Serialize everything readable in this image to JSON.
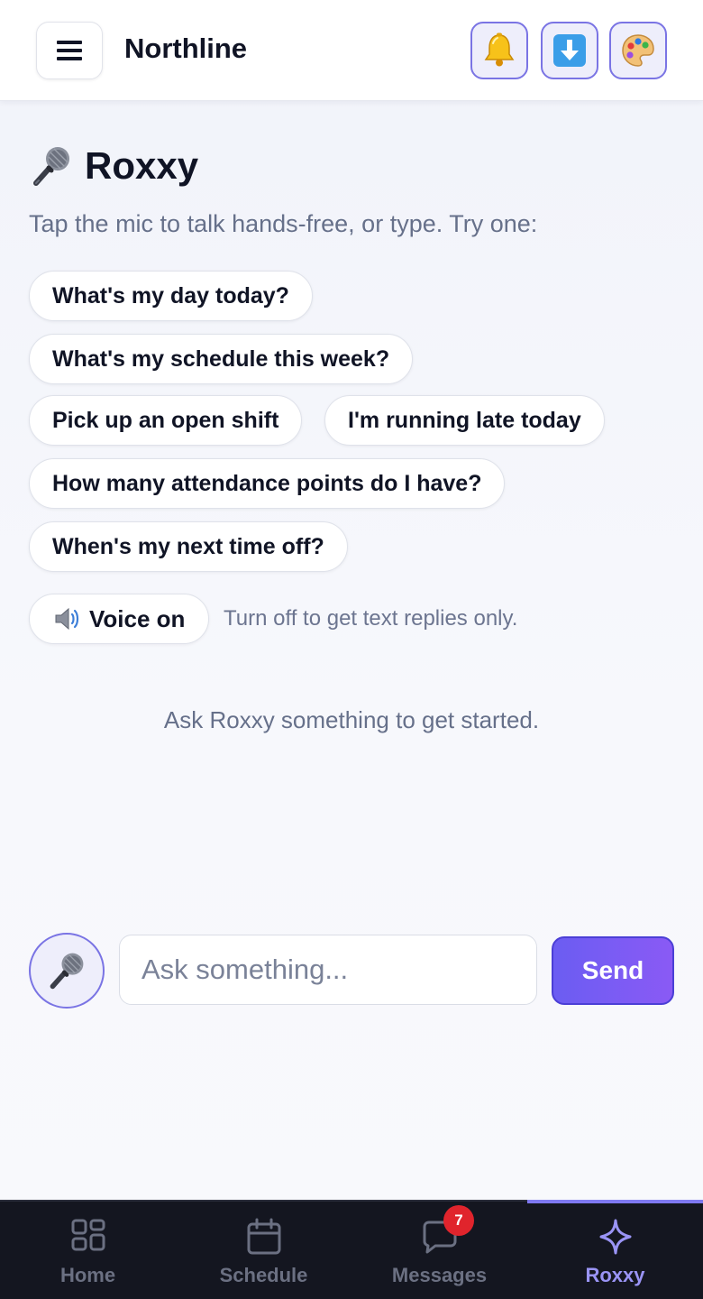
{
  "header": {
    "app_title": "Northline",
    "menu_icon": "hamburger-icon",
    "actions": [
      {
        "name": "notifications",
        "icon": "bell-icon"
      },
      {
        "name": "download",
        "icon": "download-arrow-icon"
      },
      {
        "name": "theme",
        "icon": "palette-icon"
      }
    ]
  },
  "assistant": {
    "title": "Roxxy",
    "title_icon": "microphone-icon",
    "subtitle": "Tap the mic to talk hands-free, or type. Try one:",
    "suggestions": [
      "What's my day today?",
      "What's my schedule this week?",
      "Pick up an open shift",
      "I'm running late today",
      "How many attendance points do I have?",
      "When's my next time off?"
    ],
    "voice_toggle": {
      "label": "Voice on",
      "icon": "speaker-icon",
      "hint": "Turn off to get text replies only."
    },
    "empty_state": "Ask Roxxy something to get started."
  },
  "composer": {
    "placeholder": "Ask something...",
    "value": "",
    "send_label": "Send",
    "mic_icon": "microphone-icon"
  },
  "bottom_nav": {
    "items": [
      {
        "label": "Home",
        "icon": "grid-icon",
        "active": false
      },
      {
        "label": "Schedule",
        "icon": "calendar-icon",
        "active": false
      },
      {
        "label": "Messages",
        "icon": "chat-bubble-icon",
        "active": false,
        "badge": "7"
      },
      {
        "label": "Roxxy",
        "icon": "sparkle-icon",
        "active": true
      }
    ]
  },
  "colors": {
    "accent": "#6b5df2",
    "accent_border": "#7a74e4",
    "nav_background": "#141620",
    "badge": "#e0242c"
  }
}
